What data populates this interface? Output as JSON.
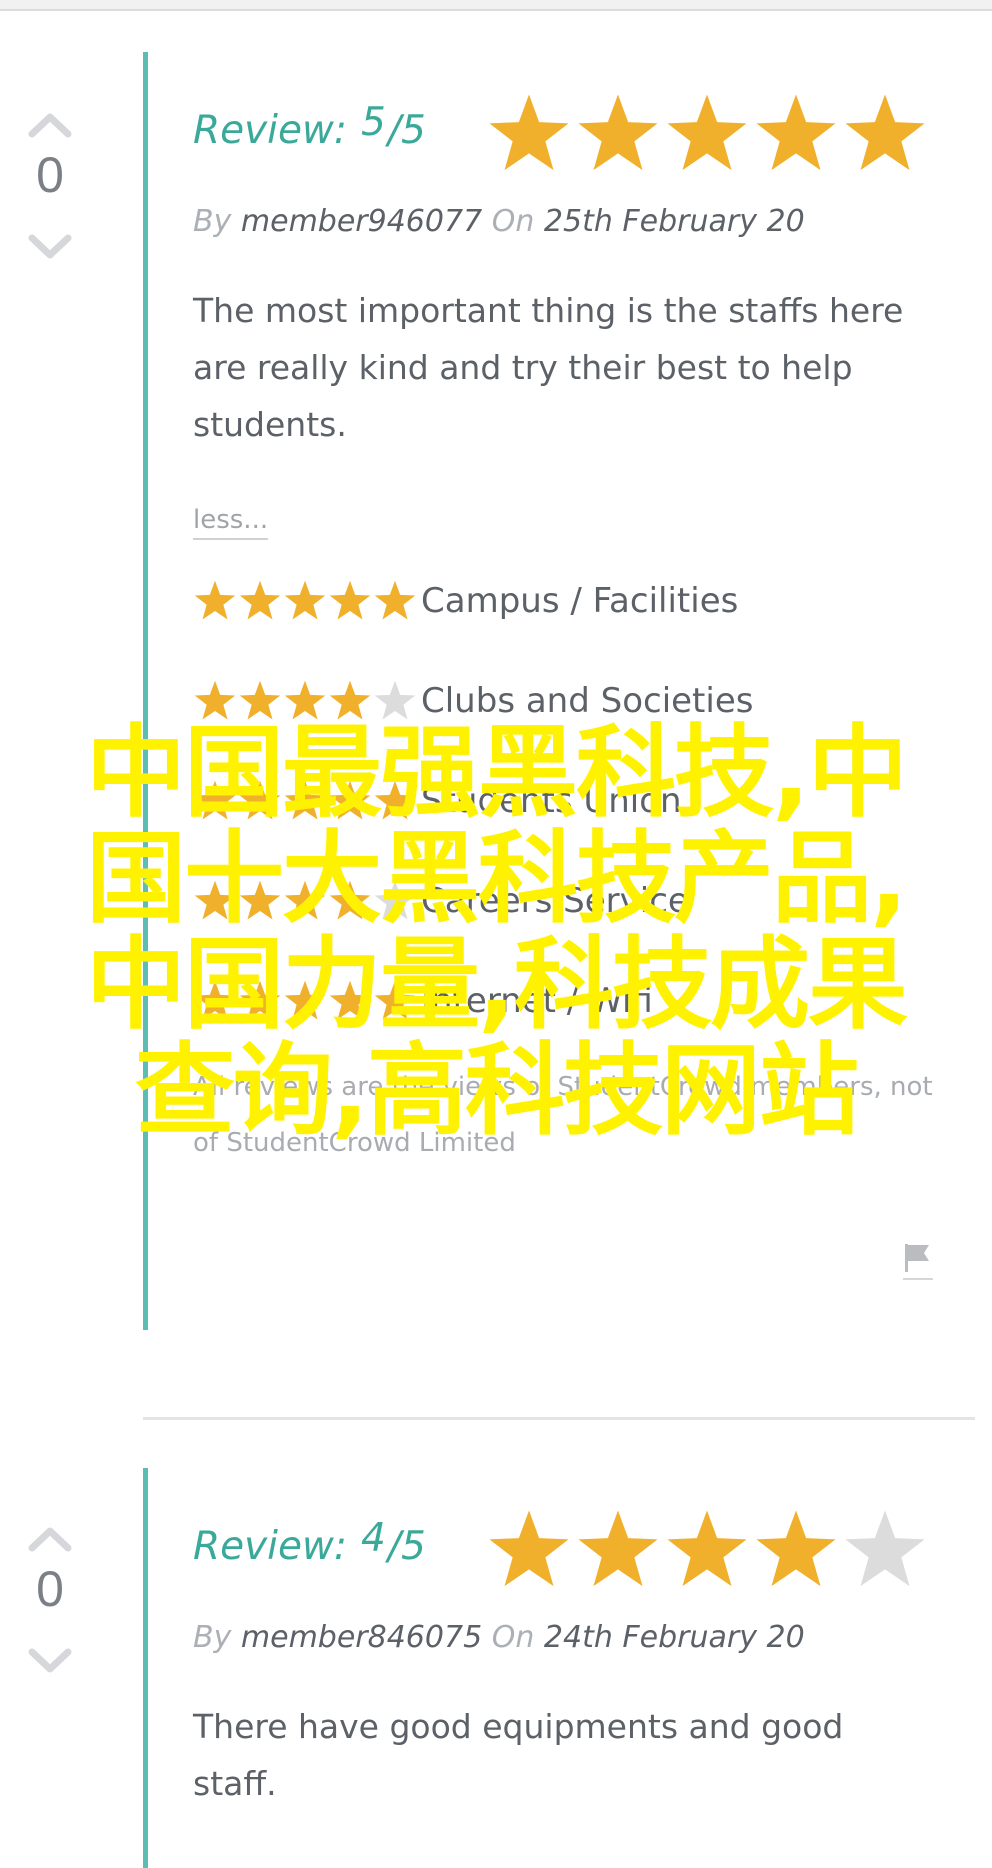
{
  "watermark": {
    "lines": [
      "中国最强黑科技,中",
      "国十大黑科技产品,",
      "中国力量,科技成果",
      "查询,高科技网站"
    ]
  },
  "reviews": [
    {
      "votes": "0",
      "review_label": "Review:",
      "score": "5",
      "out_of": "/5",
      "rating": 5,
      "by_label": "By",
      "member": "member946077",
      "on_label": "On",
      "date": "25th February 20",
      "text": "The most important thing is the staffs here are really kind and try their best to help students.",
      "less_label": "less...",
      "categories": [
        {
          "label": "Campus / Facilities",
          "rating": 5
        },
        {
          "label": "Clubs and Societies",
          "rating": 4
        },
        {
          "label": "Students Union",
          "rating": 5
        },
        {
          "label": "Careers Service",
          "rating": 4
        },
        {
          "label": "Internet / Wifi",
          "rating": 5
        }
      ],
      "disclaimer": "All reviews are the views of StudentCrowd members, not of StudentCrowd Limited"
    },
    {
      "votes": "0",
      "review_label": "Review:",
      "score": "4",
      "out_of": "/5",
      "rating": 4,
      "by_label": "By",
      "member": "member846075",
      "on_label": "On",
      "date": "24th February 20",
      "text": "There have good equipments and good staff."
    }
  ],
  "colors": {
    "accent_teal": "#3aa99a",
    "bar_teal": "#5bbdb3",
    "star_filled": "#f0b02b",
    "star_empty": "#dcdcdc",
    "watermark": "#fff200"
  },
  "icons": {
    "upvote": "chevron-up-icon",
    "downvote": "chevron-down-icon",
    "star": "star-icon",
    "flag": "flag-icon"
  }
}
